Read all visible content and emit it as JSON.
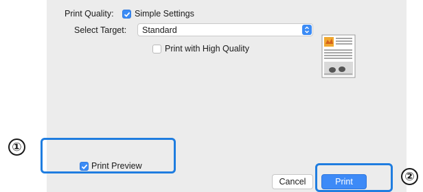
{
  "print_quality": {
    "label": "Print Quality:",
    "simple_settings_label": "Simple Settings",
    "simple_settings_checked": true
  },
  "select_target": {
    "label": "Select Target:",
    "value": "Standard"
  },
  "high_quality": {
    "label": "Print with High Quality",
    "checked": false
  },
  "print_preview": {
    "label": "Print Preview",
    "checked": true
  },
  "buttons": {
    "cancel_label": "Cancel",
    "print_label": "Print"
  },
  "callouts": {
    "one": "①",
    "two": "②"
  },
  "colors": {
    "accent": "#3b8bf5",
    "callout": "#1f7de0",
    "dialog_bg": "#ececec"
  }
}
